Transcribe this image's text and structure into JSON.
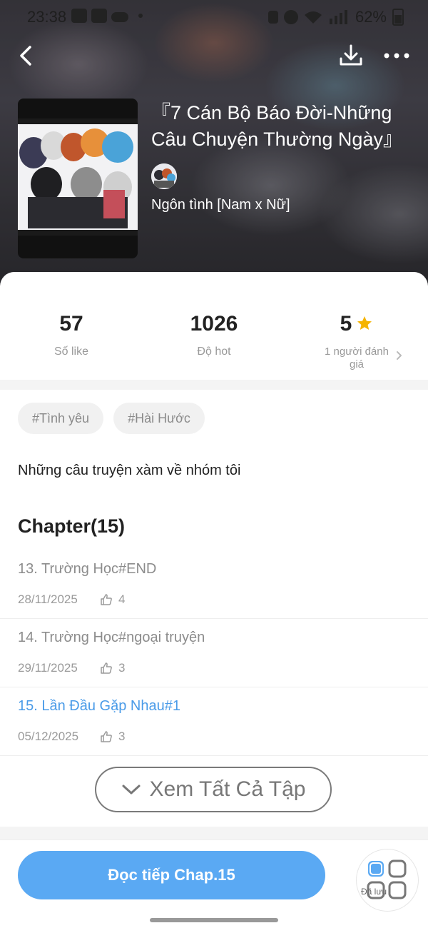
{
  "status_bar": {
    "time": "23:38",
    "battery": "62%"
  },
  "novel": {
    "title": "『7 Cán Bộ Báo Đời-Những Câu Chuyện Thường Ngày』",
    "genre": "Ngôn tình [Nam x Nữ]"
  },
  "stats": {
    "likes": {
      "value": "57",
      "label": "Số like"
    },
    "hot": {
      "value": "1026",
      "label": "Độ hot"
    },
    "rating": {
      "value": "5",
      "label": "1 người đánh giá"
    }
  },
  "tags": [
    "#Tình yêu",
    "#Hài Hước"
  ],
  "description": "Những câu truyện xàm về nhóm tôi",
  "chapters": {
    "heading": "Chapter(15)",
    "items": [
      {
        "title": "13. Trường Học#END",
        "date": "28/11/2025",
        "likes": "4"
      },
      {
        "title": "14. Trường Học#ngoại truyện",
        "date": "29/11/2025",
        "likes": "3"
      },
      {
        "title": "15. Lần Đầu Gặp Nhau#1",
        "date": "05/12/2025",
        "likes": "3"
      }
    ],
    "see_all": "Xem Tất Cả Tập"
  },
  "actions": {
    "continue_read": "Đọc tiếp Chap.15",
    "saved": "Đã lưu"
  },
  "colors": {
    "accent": "#5aa9f3",
    "current_chapter": "#4a9be8",
    "star": "#f5b400"
  }
}
